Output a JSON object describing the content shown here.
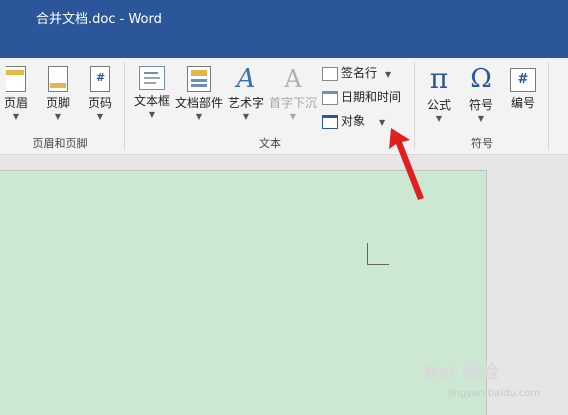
{
  "window": {
    "title": "合并文档.doc - Word"
  },
  "ribbon": {
    "header_footer_group": {
      "label": "页眉和页脚",
      "buttons": [
        {
          "label": "页眉"
        },
        {
          "label": "页脚"
        },
        {
          "label": "页码"
        }
      ]
    },
    "text_group": {
      "label": "文本",
      "buttons": [
        {
          "label": "文本框"
        },
        {
          "label": "文档部件"
        },
        {
          "label": "艺术字"
        },
        {
          "label": "首字下沉"
        }
      ],
      "small_buttons": [
        {
          "label": "签名行"
        },
        {
          "label": "日期和时间"
        },
        {
          "label": "对象"
        }
      ]
    },
    "symbols_group": {
      "label": "符号",
      "buttons": [
        {
          "label": "公式",
          "icon_text": "π"
        },
        {
          "label": "符号",
          "icon_text": "Ω"
        },
        {
          "label": "编号",
          "icon_text": "#"
        }
      ]
    }
  },
  "page_number_icon_text": "#",
  "wordart_icon_text": "A",
  "dropcap_icon_text": "A",
  "watermark": {
    "text": "Bai 经验",
    "url": "jingyan.baidu.com"
  },
  "colors": {
    "title_bar": "#2b579a",
    "document_bg": "#cde8d2",
    "arrow": "#e02020"
  }
}
